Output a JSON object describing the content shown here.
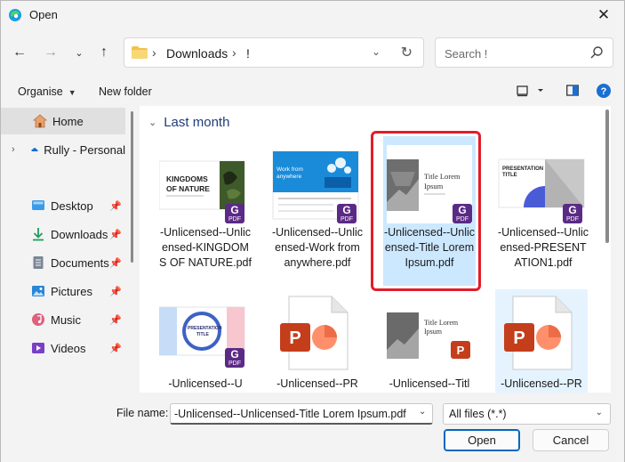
{
  "window": {
    "title": "Open"
  },
  "address": {
    "crumbs": [
      "Downloads",
      "!"
    ]
  },
  "search": {
    "placeholder": "Search !"
  },
  "toolbar": {
    "organise": "Organise",
    "new_folder": "New folder"
  },
  "sidebar": {
    "items": [
      {
        "label": "Home",
        "icon": "home-icon",
        "pinned": false
      },
      {
        "label": "Rully - Personal",
        "icon": "onedrive-icon",
        "pinned": false
      },
      {
        "label": "Desktop",
        "icon": "desktop-icon",
        "pinned": true
      },
      {
        "label": "Downloads",
        "icon": "download-icon",
        "pinned": true
      },
      {
        "label": "Documents",
        "icon": "documents-icon",
        "pinned": true
      },
      {
        "label": "Pictures",
        "icon": "pictures-icon",
        "pinned": true
      },
      {
        "label": "Music",
        "icon": "music-icon",
        "pinned": true
      },
      {
        "label": "Videos",
        "icon": "videos-icon",
        "pinned": true
      }
    ]
  },
  "group": {
    "label": "Last month"
  },
  "files": [
    {
      "name": "-Unlicensed--Unlicensed-KINGDOMS OF NATURE.pdf",
      "thumb_title": "KINGDOMS OF NATURE"
    },
    {
      "name": "-Unlicensed--Unlicensed-Work from anywhere.pdf",
      "thumb_title": "Work from anywhere"
    },
    {
      "name": "-Unlicensed--Unlicensed-Title Lorem Ipsum.pdf",
      "thumb_title": "Title Lorem Ipsum",
      "selected": true
    },
    {
      "name": "-Unlicensed--Unlicensed-PRESENTATION1.pdf",
      "thumb_title": "PRESENTATION TITLE"
    },
    {
      "name": "-Unlicensed--U",
      "thumb_title": "PRESENTATION TITLE"
    },
    {
      "name": "-Unlicensed--PR",
      "thumb_title": ""
    },
    {
      "name": "-Unlicensed--Titl",
      "thumb_title": "Title Lorem Ipsum"
    },
    {
      "name": "-Unlicensed--PR",
      "thumb_title": ""
    }
  ],
  "footer": {
    "file_name_label": "File name:",
    "file_name_value": "-Unlicensed--Unlicensed-Title Lorem Ipsum.pdf",
    "file_type": "All files (*.*)",
    "open_label": "Open",
    "cancel_label": "Cancel"
  },
  "colors": {
    "accent": "#0067c0",
    "selection": "#cce8ff",
    "highlight": "#e11d2a",
    "pdf_badge": "#5b2a86"
  }
}
